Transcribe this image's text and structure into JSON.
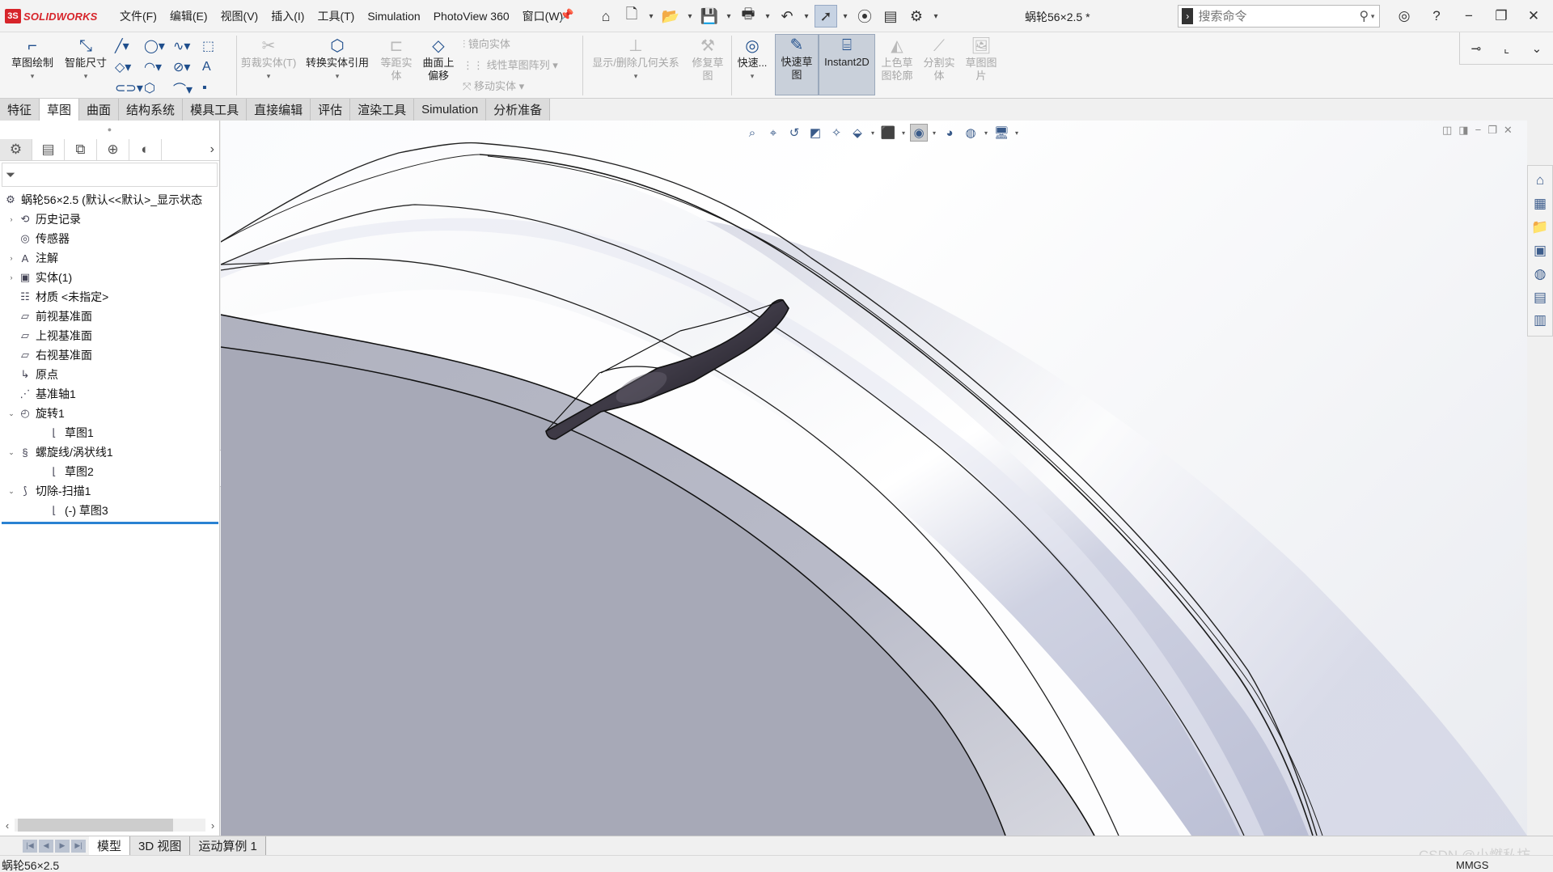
{
  "app": {
    "logo_prefix": "3S",
    "logo_text": "SOLIDWORKS",
    "doc_title": "蜗轮56×2.5 *"
  },
  "menus": [
    "文件(F)",
    "编辑(E)",
    "视图(V)",
    "插入(I)",
    "工具(T)",
    "Simulation",
    "PhotoView 360",
    "窗口(W)"
  ],
  "search": {
    "placeholder": "搜索命令"
  },
  "ribbon": {
    "sketch": "草图绘制",
    "smart_dim": "智能尺寸",
    "trim": "剪裁实体(T)",
    "convert": "转换实体引用",
    "offset_1": "等距实",
    "offset_2": "体",
    "surf_offset_1": "曲面上",
    "surf_offset_2": "偏移",
    "mirror": "镜向实体",
    "linear_pattern": "线性草图阵列",
    "move": "移动实体",
    "relations": "显示/删除几何关系",
    "repair_1": "修复草",
    "repair_2": "图",
    "quick_snap": "快速...",
    "rapid_1": "快速草",
    "rapid_2": "图",
    "instant2d": "Instant2D",
    "shaded_1": "上色草",
    "shaded_2": "图轮廓",
    "split_1": "分割实",
    "split_2": "体",
    "picture_1": "草图图",
    "picture_2": "片"
  },
  "tabs": [
    "特征",
    "草图",
    "曲面",
    "结构系统",
    "模具工具",
    "直接编辑",
    "评估",
    "渲染工具",
    "Simulation",
    "分析准备"
  ],
  "active_tab": "草图",
  "tree": [
    {
      "label": "蜗轮56×2.5  (默认<<默认>_显示状态",
      "level": 0,
      "expand": "",
      "icon": "part-icon"
    },
    {
      "label": "历史记录",
      "level": 1,
      "expand": "›",
      "icon": "history-icon"
    },
    {
      "label": "传感器",
      "level": 1,
      "expand": "",
      "icon": "sensor-icon"
    },
    {
      "label": "注解",
      "level": 1,
      "expand": "›",
      "icon": "annotation-icon"
    },
    {
      "label": "实体(1)",
      "level": 1,
      "expand": "›",
      "icon": "solid-bodies-icon"
    },
    {
      "label": "材质 <未指定>",
      "level": 1,
      "expand": "",
      "icon": "material-icon"
    },
    {
      "label": "前视基准面",
      "level": 1,
      "expand": "",
      "icon": "plane-icon"
    },
    {
      "label": "上视基准面",
      "level": 1,
      "expand": "",
      "icon": "plane-icon"
    },
    {
      "label": "右视基准面",
      "level": 1,
      "expand": "",
      "icon": "plane-icon"
    },
    {
      "label": "原点",
      "level": 1,
      "expand": "",
      "icon": "origin-icon"
    },
    {
      "label": "基准轴1",
      "level": 1,
      "expand": "",
      "icon": "axis-icon"
    },
    {
      "label": "旋转1",
      "level": 1,
      "expand": "⌄",
      "icon": "revolve-icon"
    },
    {
      "label": "草图1",
      "level": 2,
      "expand": "",
      "icon": "sketch-icon"
    },
    {
      "label": "螺旋线/涡状线1",
      "level": 1,
      "expand": "⌄",
      "icon": "helix-icon"
    },
    {
      "label": "草图2",
      "level": 2,
      "expand": "",
      "icon": "sketch-icon"
    },
    {
      "label": "切除-扫描1",
      "level": 1,
      "expand": "⌄",
      "icon": "cut-sweep-icon"
    },
    {
      "label": "(-) 草图3",
      "level": 2,
      "expand": "",
      "icon": "sketch-icon"
    }
  ],
  "bottom_tabs": [
    "模型",
    "3D 视图",
    "运动算例 1"
  ],
  "active_bottom_tab": "模型",
  "status": {
    "left": "蜗轮56×2.5",
    "units": "MMGS"
  },
  "watermark": "CSDN @小燃私坊",
  "colors": {
    "accent": "#2a82d2",
    "logo_red": "#d7242a",
    "body_steel": "#a9aab8",
    "cut_dark": "#2b2930"
  }
}
